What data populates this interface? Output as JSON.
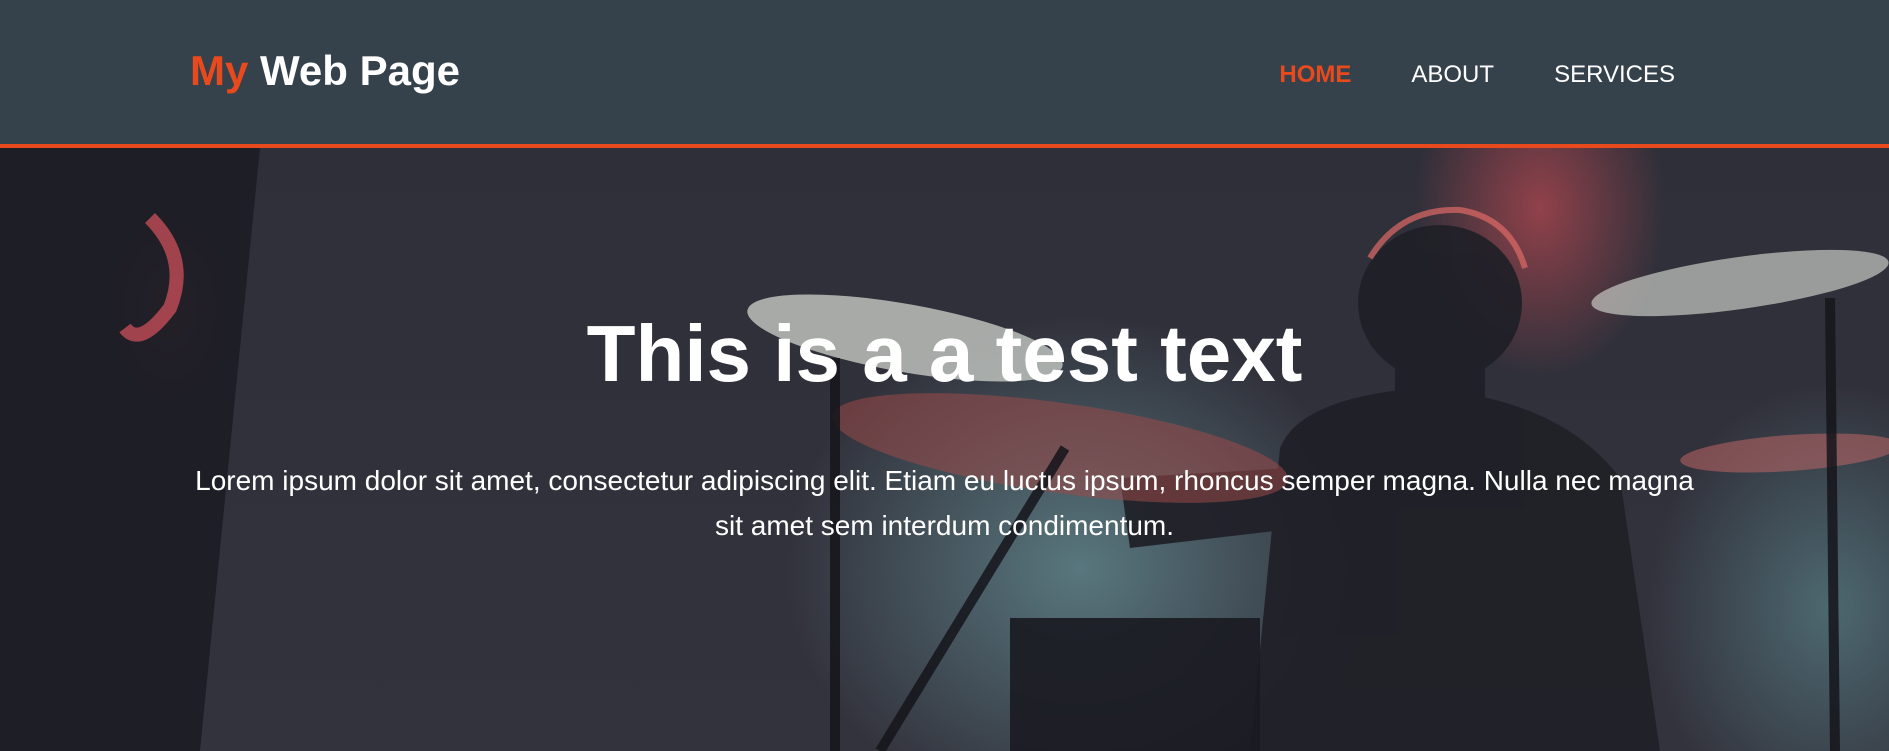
{
  "header": {
    "logo_highlight": "My",
    "logo_rest": "Web Page",
    "nav": [
      {
        "label": "HOME",
        "active": true
      },
      {
        "label": "ABOUT",
        "active": false
      },
      {
        "label": "SERVICES",
        "active": false
      }
    ]
  },
  "hero": {
    "title": "This is a a test text",
    "text": "Lorem ipsum dolor sit amet, consectetur adipiscing elit. Etiam eu luctus ipsum, rhoncus semper magna. Nulla nec magna sit amet sem interdum condimentum."
  },
  "colors": {
    "accent": "#e8491d",
    "header_bg": "#35424b",
    "text": "#ffffff"
  }
}
